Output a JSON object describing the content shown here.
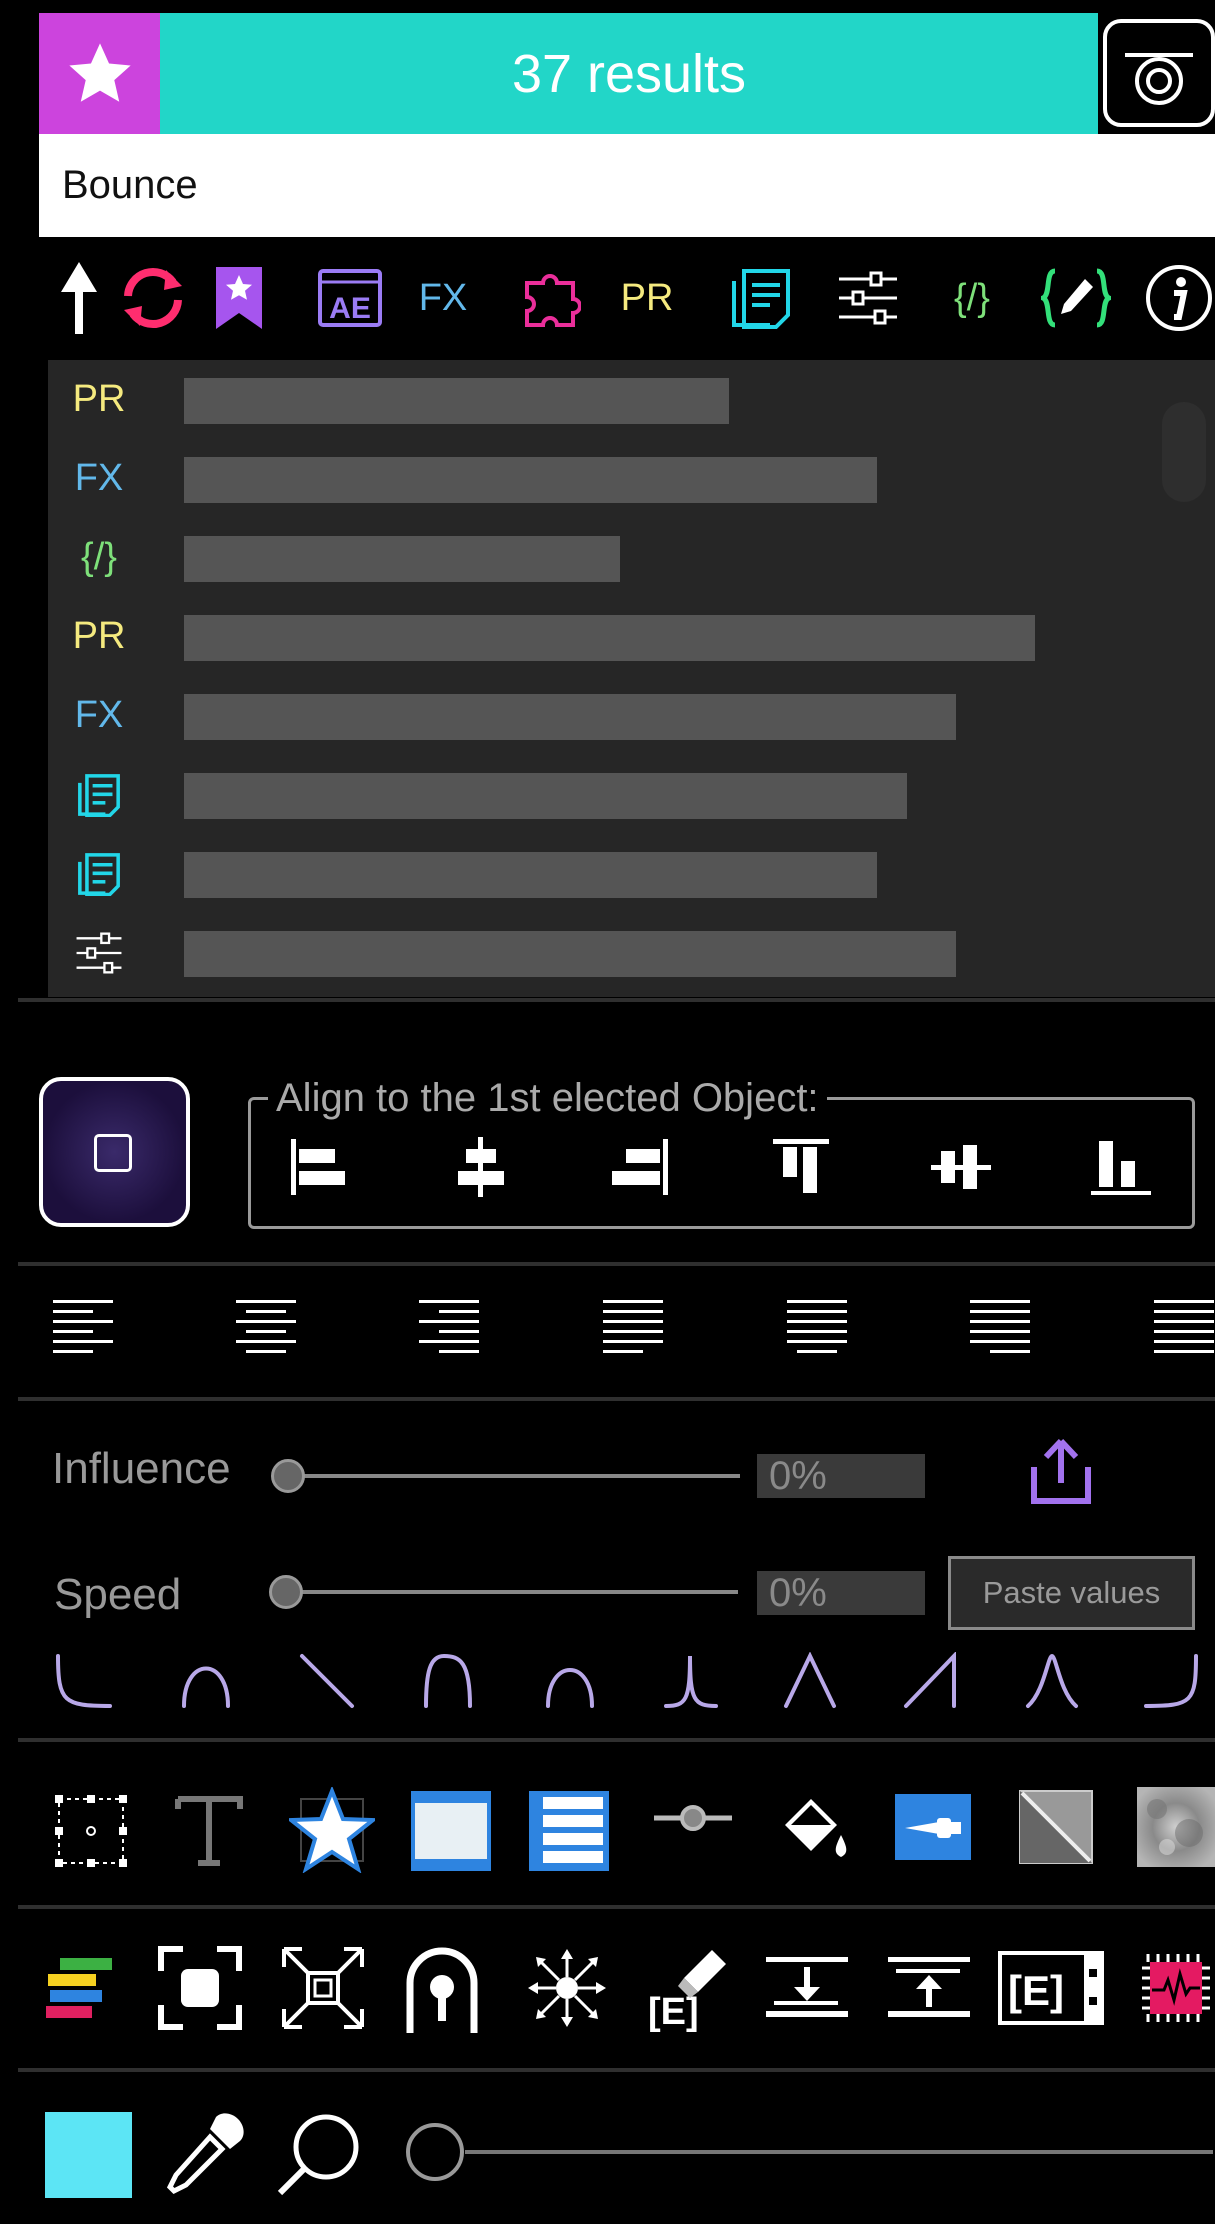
{
  "header": {
    "results_label": "37 results",
    "search": {
      "value": "Bounce",
      "placeholder": ""
    },
    "icons": [
      "star-icon",
      "camera-icon"
    ]
  },
  "toolbar": {
    "items": [
      {
        "name": "arrow-up-icon"
      },
      {
        "name": "refresh-icon",
        "color": "#ff2d6f"
      },
      {
        "name": "bookmark-star-icon",
        "color": "#a655ee"
      },
      {
        "name": "after-effects-icon",
        "label": "AE",
        "color": "#9b7cf5"
      },
      {
        "name": "fx-tab",
        "label": "FX",
        "color": "#62b8ea"
      },
      {
        "name": "puzzle-icon",
        "color": "#ea2e9a"
      },
      {
        "name": "pr-tab",
        "label": "PR",
        "color": "#f5ea7f"
      },
      {
        "name": "document-icon",
        "color": "#22d6e8"
      },
      {
        "name": "sliders-icon",
        "color": "#ffffff"
      },
      {
        "name": "code-tab",
        "label": "{/}",
        "color": "#7ee07a"
      },
      {
        "name": "code-edit-icon",
        "color": "#33e07a"
      },
      {
        "name": "info-icon",
        "color": "#ffffff"
      }
    ]
  },
  "results": {
    "rows": [
      {
        "tag": "PR",
        "color": "#f5ea7f",
        "fill": 0.55
      },
      {
        "tag": "FX",
        "color": "#62b8ea",
        "fill": 0.7
      },
      {
        "tag": "{/}",
        "color": "#7ee07a",
        "fill": 0.44
      },
      {
        "tag": "PR",
        "color": "#f5ea7f",
        "fill": 0.86
      },
      {
        "tag": "FX",
        "color": "#62b8ea",
        "fill": 0.78
      },
      {
        "tag": "",
        "icon": "document-icon",
        "color": "#22d6e8",
        "fill": 0.73
      },
      {
        "tag": "",
        "icon": "document-icon",
        "color": "#22d6e8",
        "fill": 0.7
      },
      {
        "tag": "",
        "icon": "sliders-icon",
        "color": "#ffffff",
        "fill": 0.78
      }
    ]
  },
  "align": {
    "legend": "Align to the 1st elected Object:",
    "buttons": [
      "align-left-icon",
      "align-center-h-icon",
      "align-right-icon",
      "align-top-icon",
      "align-middle-v-icon",
      "align-bottom-icon"
    ]
  },
  "text_align": {
    "buttons": [
      "text-align-left-icon",
      "text-align-center-icon",
      "text-align-right-icon",
      "text-justify-left-icon",
      "text-justify-center-icon",
      "text-justify-right-icon",
      "text-justify-all-icon"
    ]
  },
  "sliders": {
    "influence": {
      "label": "Influence",
      "value_text": "0%",
      "value": 0
    },
    "speed": {
      "label": "Speed",
      "value_text": "0%",
      "value": 0
    },
    "paste_label": "Paste values",
    "share_icon": "share-icon"
  },
  "easing": {
    "curves": [
      "ease-curve-1",
      "ease-curve-2",
      "ease-curve-3",
      "ease-curve-4",
      "ease-curve-5",
      "ease-curve-6",
      "ease-curve-7",
      "ease-curve-8",
      "ease-curve-9",
      "ease-curve-10"
    ],
    "color": "#b8a8e8"
  },
  "tools_row1": [
    "anchor-point-icon",
    "text-tool-icon",
    "star-shape-icon",
    "solid-layer-icon",
    "text-layer-icon",
    "null-slider-icon",
    "paint-bucket-icon",
    "color-picker-icon",
    "gradient-icon",
    "noise-texture-icon"
  ],
  "tools_row2": [
    "layer-colors-icon",
    "fit-to-comp-icon",
    "fit-to-frame-icon",
    "mask-icon",
    "split-icon",
    "clear-expression-icon",
    "move-down-icon",
    "move-up-icon",
    "expression-panel-icon",
    "cpu-icon"
  ],
  "bottom": {
    "swatch_color": "#5ce5f5",
    "icons": [
      "eyedropper-icon",
      "search-icon"
    ],
    "zoom_value": 0
  }
}
